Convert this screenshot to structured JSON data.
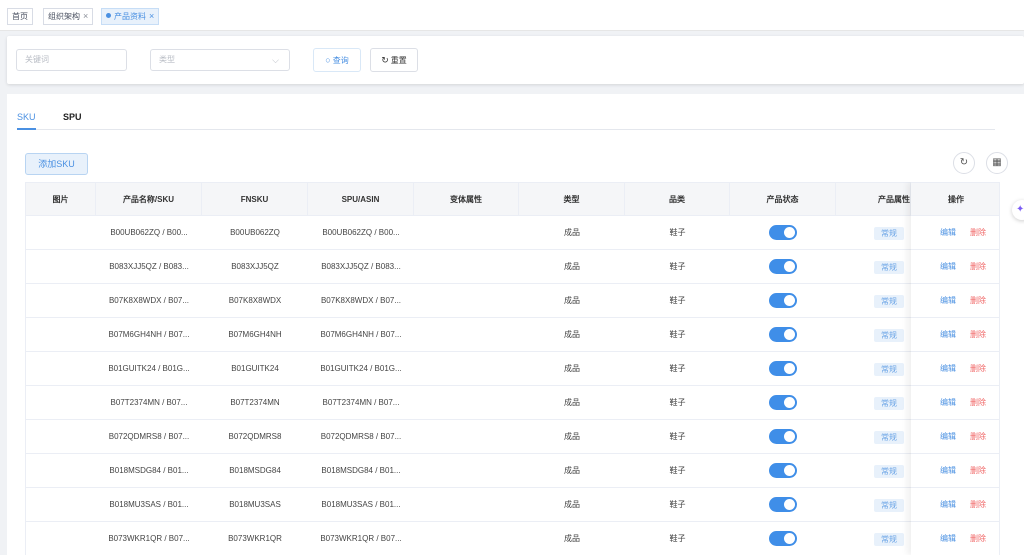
{
  "tags": [
    {
      "label": "首页",
      "active": false,
      "closable": false
    },
    {
      "label": "组织架构",
      "active": false,
      "closable": true
    },
    {
      "label": "产品资料",
      "active": true,
      "closable": true
    }
  ],
  "filter": {
    "keyword_placeholder": "关键词",
    "type_placeholder": "类型",
    "search_label": "查询",
    "reset_label": "重置"
  },
  "tabs": [
    "SKU",
    "SPU"
  ],
  "add_button": "添加SKU",
  "table": {
    "columns": [
      "图片",
      "产品名称/SKU",
      "FNSKU",
      "SPU/ASIN",
      "变体属性",
      "类型",
      "品类",
      "产品状态",
      "产品属性",
      "操作"
    ],
    "rows": [
      {
        "name": "B00UB062ZQ / B00...",
        "fnsku": "B00UB062ZQ",
        "spu": "B00UB062ZQ / B00...",
        "type": "成品",
        "category": "鞋子",
        "status_on": true,
        "attr": "常规"
      },
      {
        "name": "B083XJJ5QZ / B083...",
        "fnsku": "B083XJJ5QZ",
        "spu": "B083XJJ5QZ / B083...",
        "type": "成品",
        "category": "鞋子",
        "status_on": true,
        "attr": "常规"
      },
      {
        "name": "B07K8X8WDX / B07...",
        "fnsku": "B07K8X8WDX",
        "spu": "B07K8X8WDX / B07...",
        "type": "成品",
        "category": "鞋子",
        "status_on": true,
        "attr": "常规"
      },
      {
        "name": "B07M6GH4NH / B07...",
        "fnsku": "B07M6GH4NH",
        "spu": "B07M6GH4NH / B07...",
        "type": "成品",
        "category": "鞋子",
        "status_on": true,
        "attr": "常规"
      },
      {
        "name": "B01GUITK24 / B01G...",
        "fnsku": "B01GUITK24",
        "spu": "B01GUITK24 / B01G...",
        "type": "成品",
        "category": "鞋子",
        "status_on": true,
        "attr": "常规"
      },
      {
        "name": "B07T2374MN / B07...",
        "fnsku": "B07T2374MN",
        "spu": "B07T2374MN / B07...",
        "type": "成品",
        "category": "鞋子",
        "status_on": true,
        "attr": "常规"
      },
      {
        "name": "B072QDMRS8 / B07...",
        "fnsku": "B072QDMRS8",
        "spu": "B072QDMRS8 / B07...",
        "type": "成品",
        "category": "鞋子",
        "status_on": true,
        "attr": "常规"
      },
      {
        "name": "B018MSDG84 / B01...",
        "fnsku": "B018MSDG84",
        "spu": "B018MSDG84 / B01...",
        "type": "成品",
        "category": "鞋子",
        "status_on": true,
        "attr": "常规"
      },
      {
        "name": "B018MU3SAS / B01...",
        "fnsku": "B018MU3SAS",
        "spu": "B018MU3SAS / B01...",
        "type": "成品",
        "category": "鞋子",
        "status_on": true,
        "attr": "常规"
      },
      {
        "name": "B073WKR1QR / B07...",
        "fnsku": "B073WKR1QR",
        "spu": "B073WKR1QR / B07...",
        "type": "成品",
        "category": "鞋子",
        "status_on": true,
        "attr": "常规"
      }
    ],
    "edit_label": "编辑",
    "delete_label": "删除"
  },
  "colors": {
    "accent": "#4a90e2",
    "danger": "#f06666",
    "toggle_on": "#3f8ee8"
  }
}
